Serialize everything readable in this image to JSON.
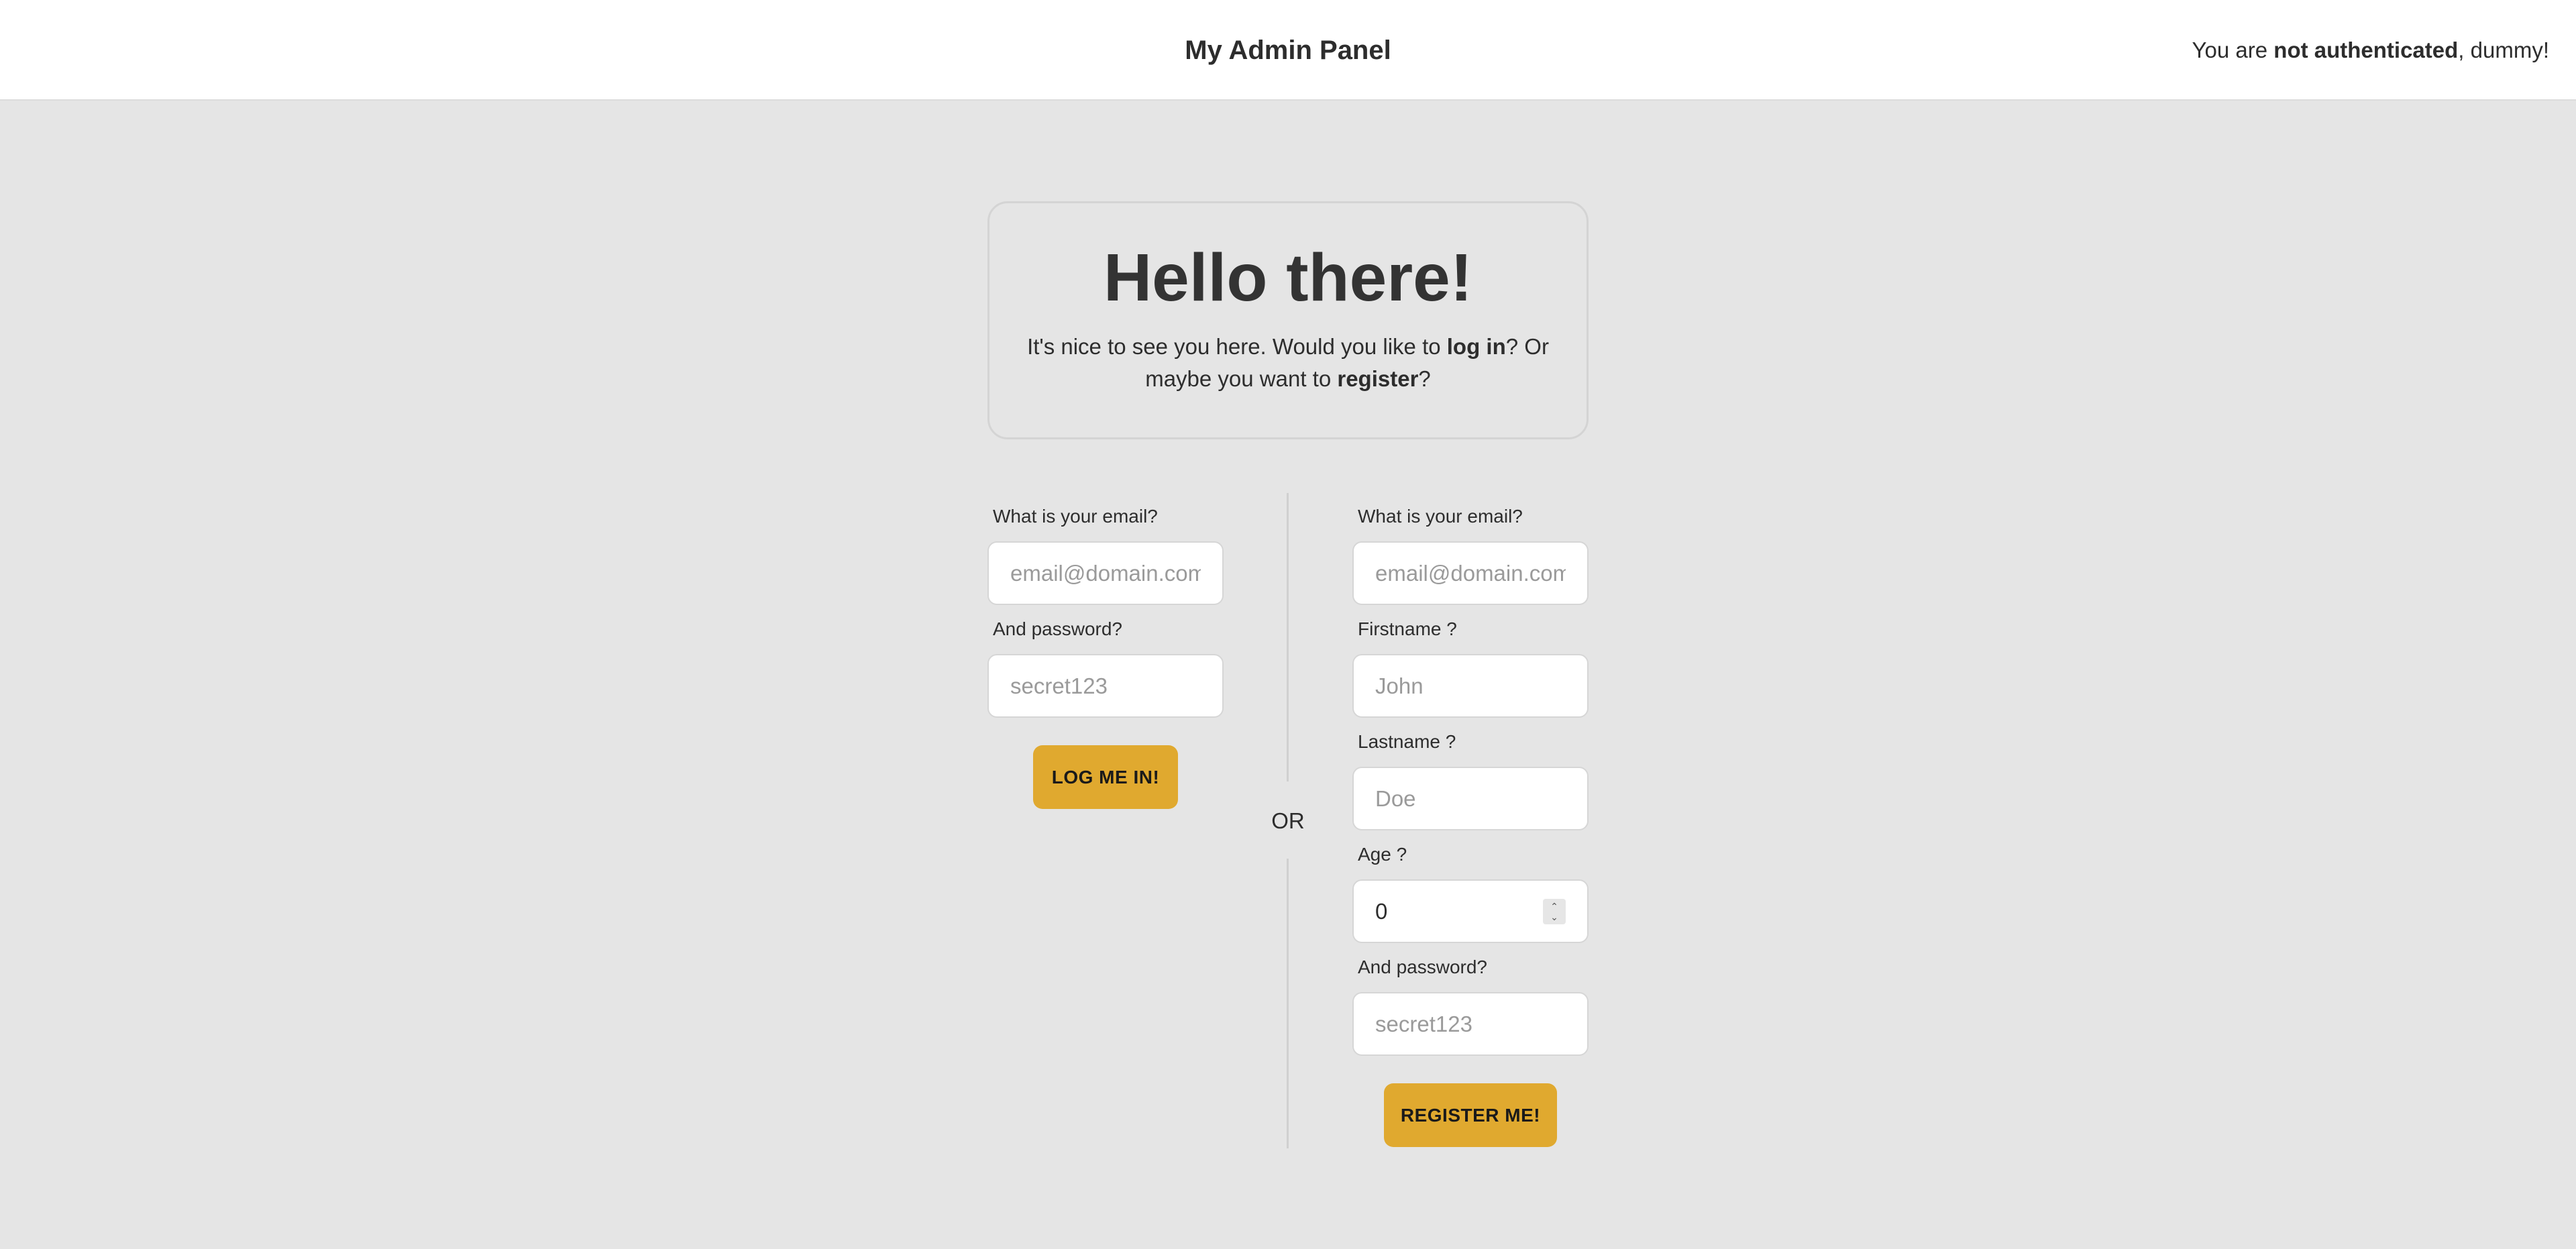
{
  "header": {
    "title": "My Admin Panel",
    "auth_prefix": "You are ",
    "auth_bold": "not authenticated",
    "auth_suffix": ", dummy!"
  },
  "hello": {
    "title": "Hello there!",
    "line_part1": "It's nice to see you here. Would you like to ",
    "login_word": "log in",
    "line_part2": "? Or maybe you want to ",
    "register_word": "register",
    "line_part3": "?"
  },
  "login": {
    "email_label": "What is your email?",
    "email_placeholder": "email@domain.com",
    "password_label": "And password?",
    "password_placeholder": "secret123",
    "submit_label": "LOG ME IN!"
  },
  "divider": {
    "or_label": "OR"
  },
  "register": {
    "email_label": "What is your email?",
    "email_placeholder": "email@domain.com",
    "firstname_label": "Firstname ?",
    "firstname_placeholder": "John",
    "lastname_label": "Lastname ?",
    "lastname_placeholder": "Doe",
    "age_label": "Age ?",
    "age_value": "0",
    "password_label": "And password?",
    "password_placeholder": "secret123",
    "submit_label": "REGISTER ME!"
  },
  "colors": {
    "accent": "#e0a92f",
    "background": "#e5e5e5",
    "header_bg": "#ffffff",
    "text": "#2d2d2d"
  },
  "icons": {
    "age_spinner": "number-spinner-icon"
  }
}
